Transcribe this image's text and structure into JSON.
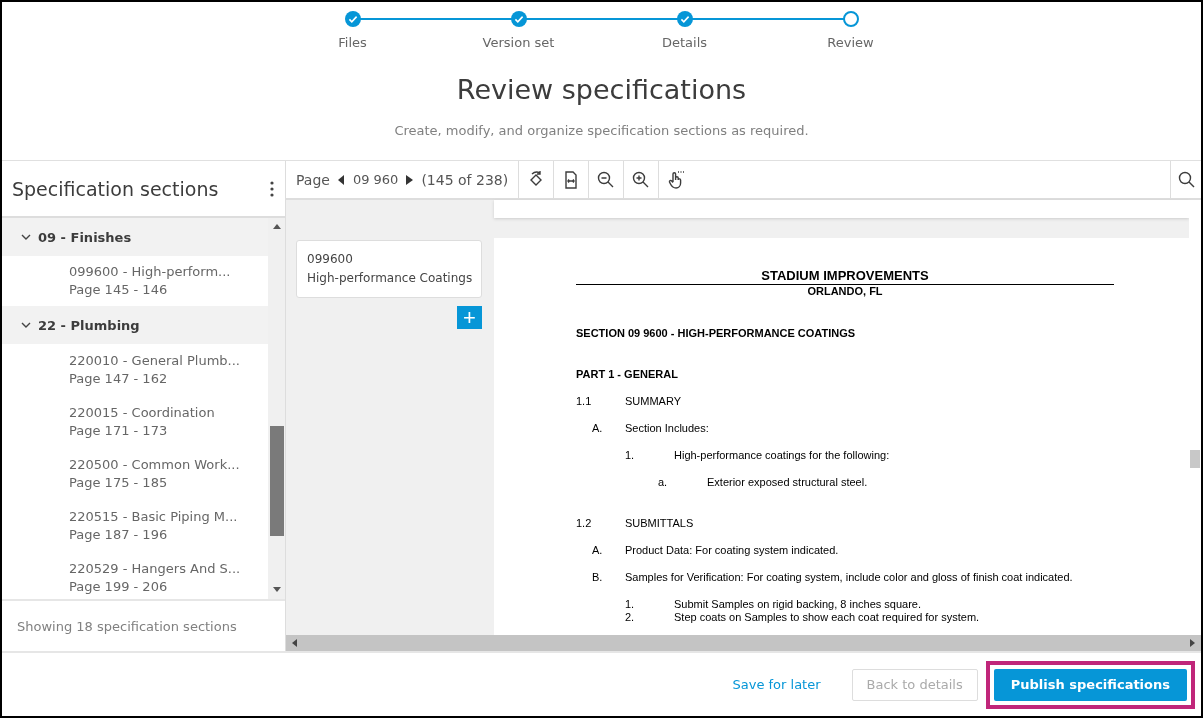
{
  "stepper": [
    {
      "label": "Files",
      "done": true
    },
    {
      "label": "Version set",
      "done": true
    },
    {
      "label": "Details",
      "done": true
    },
    {
      "label": "Review",
      "done": false
    }
  ],
  "title": "Review specifications",
  "subtitle": "Create, modify, and organize specification sections as required.",
  "sidebar": {
    "title": "Specification sections",
    "groups": [
      {
        "label": "09 - Finishes",
        "expanded": true,
        "children": [
          {
            "label": "099600 - High-perform...",
            "pages": "Page 145 - 146",
            "selected": true
          }
        ]
      },
      {
        "label": "22 - Plumbing",
        "expanded": true,
        "children": [
          {
            "label": "220010 - General Plumb...",
            "pages": "Page 147 - 162",
            "selected": false
          },
          {
            "label": "220015 - Coordination",
            "pages": "Page 171 - 173",
            "selected": false
          },
          {
            "label": "220500 - Common Work...",
            "pages": "Page 175 - 185",
            "selected": false
          },
          {
            "label": "220515 - Basic Piping M...",
            "pages": "Page 187 - 196",
            "selected": false
          },
          {
            "label": "220529 - Hangers And S...",
            "pages": "Page 199 - 206",
            "selected": false
          }
        ]
      }
    ],
    "footer": "Showing 18 specification sections"
  },
  "toolbar": {
    "page_label": "Page",
    "page_value": "09 960",
    "page_count": "(145 of 238)"
  },
  "section_card": {
    "number": "099600",
    "name": "High-performance Coatings",
    "add_button": "+"
  },
  "document": {
    "lines": [
      {
        "kind": "title",
        "text": "STADIUM IMPROVEMENTS"
      },
      {
        "kind": "subtitle",
        "text": "ORLANDO, FL"
      },
      {
        "kind": "section",
        "text": "SECTION 09 9600 - HIGH-PERFORMANCE COATINGS"
      },
      {
        "kind": "part",
        "text": "PART 1 - GENERAL"
      },
      {
        "kind": "article",
        "num": "1.1",
        "text": "SUMMARY"
      },
      {
        "kind": "para",
        "num": "A.",
        "text": "Section Includes:"
      },
      {
        "kind": "sub",
        "num": "1.",
        "text": "High-performance coatings for the following:"
      },
      {
        "kind": "subsub",
        "num": "a.",
        "text": "Exterior exposed structural steel."
      },
      {
        "kind": "article",
        "num": "1.2",
        "text": "SUBMITTALS"
      },
      {
        "kind": "para",
        "num": "A.",
        "text": "Product Data:  For coating system indicated."
      },
      {
        "kind": "para",
        "num": "B.",
        "text": "Samples for Verification:  For coating system, include color and gloss of finish coat indicated."
      },
      {
        "kind": "sub",
        "num": "1.",
        "text": "Submit Samples on rigid backing, 8 inches square."
      },
      {
        "kind": "tight",
        "num": "2.",
        "text": "Step coats on Samples to show each coat required for system."
      }
    ]
  },
  "actions": [
    {
      "kind": "link",
      "label": "Save for later",
      "disabled": false,
      "highlighted": false
    },
    {
      "kind": "secondary",
      "label": "Back to details",
      "disabled": true,
      "highlighted": false
    },
    {
      "kind": "primary",
      "label": "Publish specifications",
      "disabled": false,
      "highlighted": true
    }
  ]
}
